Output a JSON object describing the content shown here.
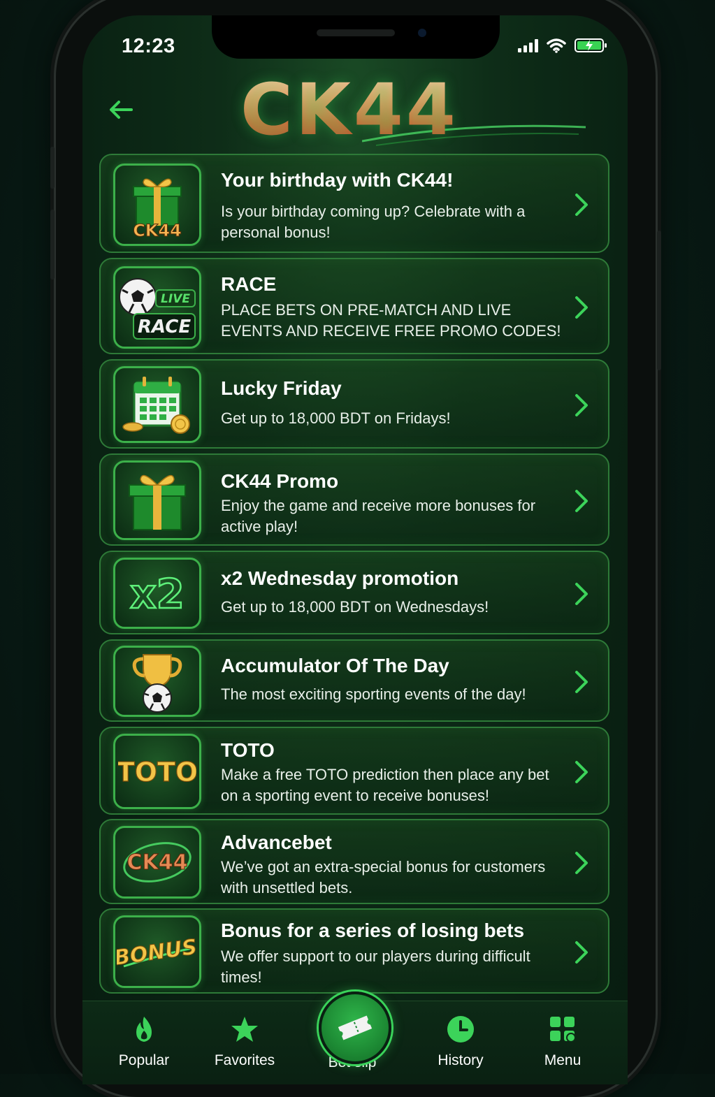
{
  "status_bar": {
    "time": "12:23"
  },
  "header": {
    "logo_text": "CK44"
  },
  "promotions": [
    {
      "title": "Your birthday with CK44!",
      "description": "Is your birthday coming up? Celebrate with a personal bonus!",
      "thumb_label": "CK44",
      "icon": "gift-box-icon"
    },
    {
      "title": "RACE",
      "description": "PLACE BETS ON PRE-MATCH AND LIVE EVENTS AND RECEIVE FREE PROMO CODES!",
      "thumb_label": "RACE",
      "thumb_badge": "LIVE",
      "icon": "soccer-ball-icon"
    },
    {
      "title": "Lucky Friday",
      "description": "Get up to 18,000 BDT on Fridays!",
      "icon": "calendar-coins-icon"
    },
    {
      "title": "CK44 Promo",
      "description": "Enjoy the game and receive more bonuses for active play!",
      "icon": "gift-box-icon"
    },
    {
      "title": "x2 Wednesday promotion",
      "description": "Get up to 18,000 BDT on Wednesdays!",
      "thumb_label": "x2",
      "icon": "x2-icon"
    },
    {
      "title": "Accumulator Of The Day",
      "description": "The most exciting sporting events of the day!",
      "icon": "trophy-ball-icon"
    },
    {
      "title": "TOTO",
      "description": "Make a free TOTO prediction then place any bet on a sporting event to receive bonuses!",
      "thumb_label": "TOTO",
      "icon": "toto-icon"
    },
    {
      "title": "Advancebet",
      "description": "We’ve got an extra-special bonus for customers with unsettled bets.",
      "thumb_label": "CK44",
      "icon": "ck44-swoosh-icon"
    },
    {
      "title": "Bonus for a series of losing bets",
      "description": "We offer support to our players during difficult times!",
      "thumb_label": "BONUS",
      "icon": "bonus-icon"
    }
  ],
  "bottom_nav": {
    "popular": "Popular",
    "favorites": "Favorites",
    "bet_slip": "Bet slip",
    "history": "History",
    "menu": "Menu"
  },
  "colors": {
    "accent": "#3cd35a",
    "logo": "#e07a48",
    "background": "#0a2213"
  }
}
